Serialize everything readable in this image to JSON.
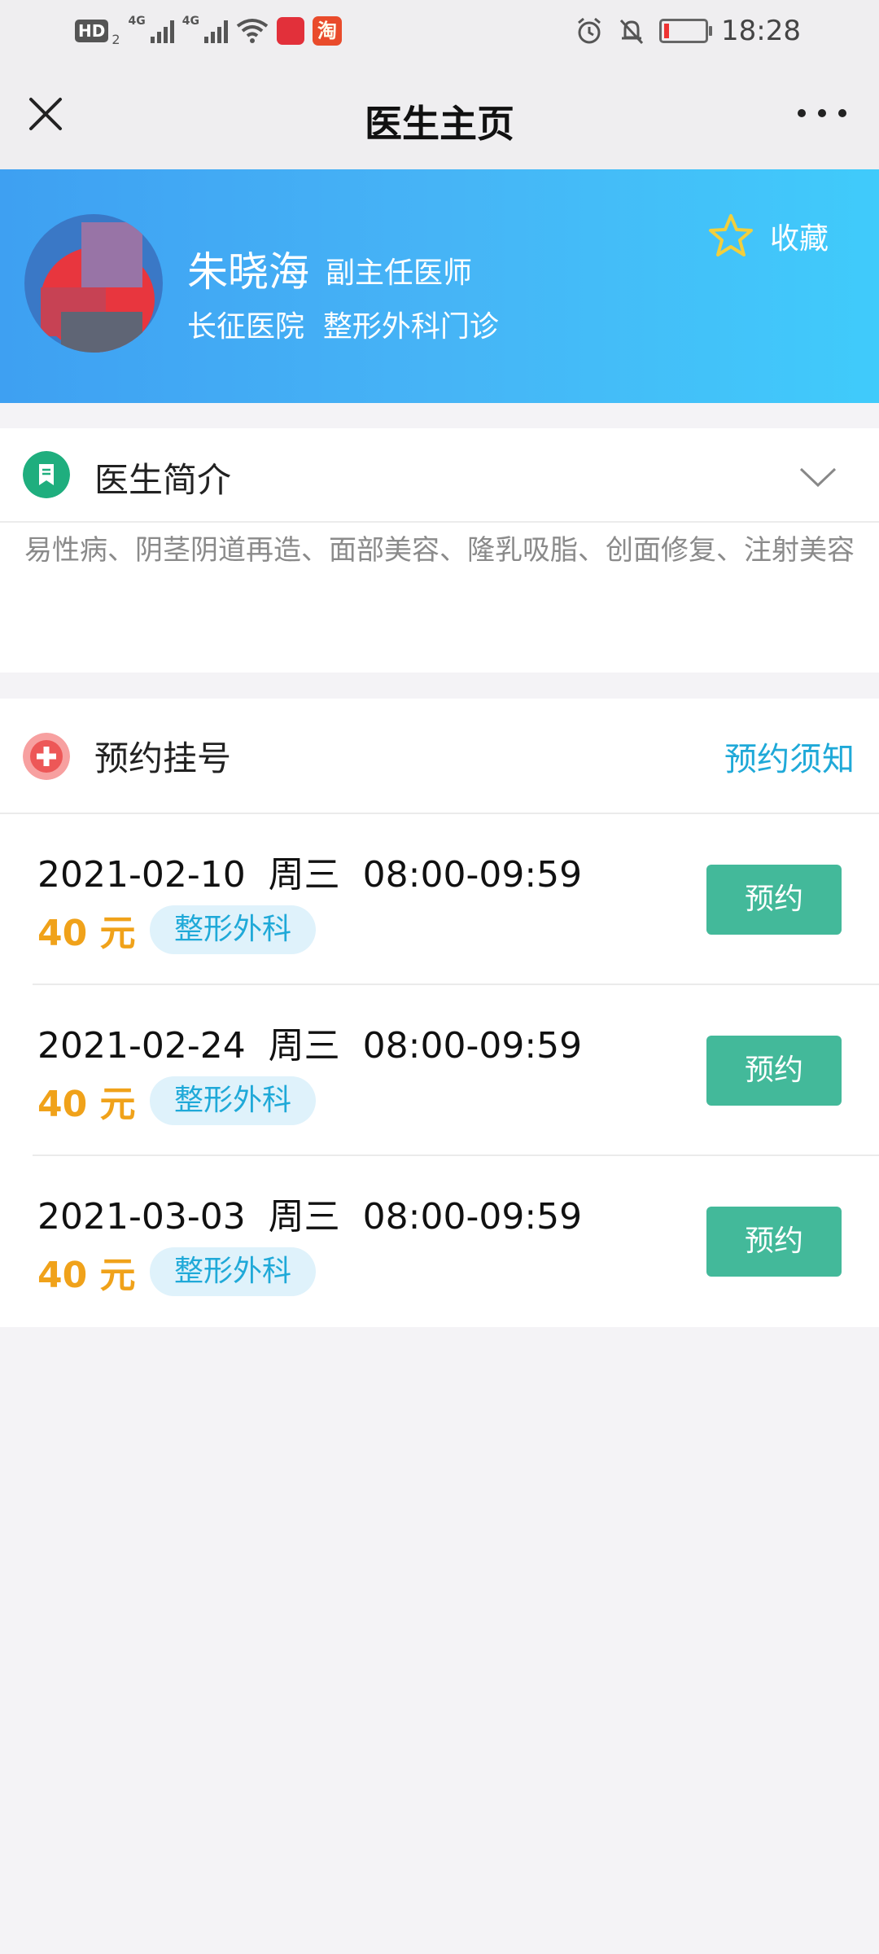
{
  "status_bar": {
    "time": "18:28",
    "hd_label": "HD",
    "hd_sub": "2",
    "net1": "4G",
    "net2": "4G",
    "taobao_glyph": "淘"
  },
  "nav": {
    "title": "医生主页",
    "close_icon": "close-icon",
    "more_icon": "more-icon"
  },
  "doctor": {
    "name": "朱晓海",
    "title": "副主任医师",
    "hospital": "长征医院",
    "department": "整形外科门诊",
    "favorite_label": "收藏"
  },
  "intro": {
    "header": "医生简介",
    "text": "易性病、阴茎阴道再造、面部美容、隆乳吸脂、创面修复、注射美容"
  },
  "booking": {
    "header": "预约挂号",
    "notice_link": "预约须知",
    "slots": [
      {
        "when": "2021-02-10  周三  08:00-09:59",
        "price": "40 元",
        "dept": "整形外科",
        "button": "预约"
      },
      {
        "when": "2021-02-24  周三  08:00-09:59",
        "price": "40 元",
        "dept": "整形外科",
        "button": "预约"
      },
      {
        "when": "2021-03-03  周三  08:00-09:59",
        "price": "40 元",
        "dept": "整形外科",
        "button": "预约"
      }
    ]
  },
  "colors": {
    "accent_green": "#43b99a",
    "price_orange": "#f0a21a",
    "link_blue": "#1fa9d8",
    "banner_blue": "#46b4f6"
  }
}
